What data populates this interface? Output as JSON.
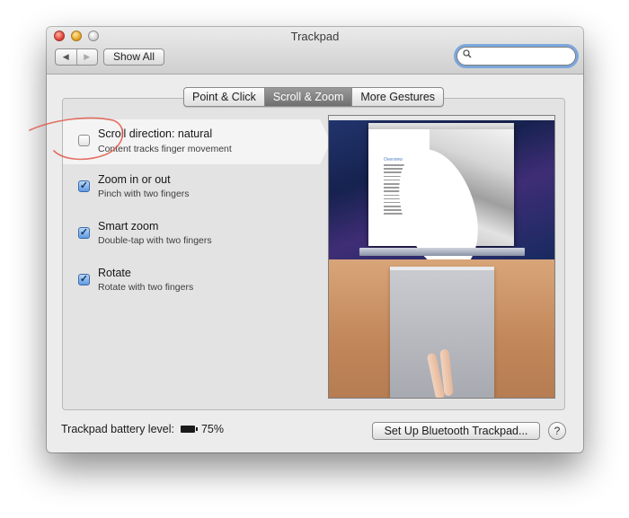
{
  "window": {
    "title": "Trackpad"
  },
  "toolbar": {
    "back_glyph": "◀",
    "forward_glyph": "▶",
    "show_all_label": "Show All",
    "search_placeholder": "",
    "search_icon": "search-icon"
  },
  "tabs": [
    {
      "label": "Point & Click",
      "active": false
    },
    {
      "label": "Scroll & Zoom",
      "active": true
    },
    {
      "label": "More Gestures",
      "active": false
    }
  ],
  "options": [
    {
      "title": "Scroll direction: natural",
      "subtitle": "Content tracks finger movement",
      "checked": false,
      "selected": true
    },
    {
      "title": "Zoom in or out",
      "subtitle": "Pinch with two fingers",
      "checked": true,
      "selected": false
    },
    {
      "title": "Smart zoom",
      "subtitle": "Double-tap with two fingers",
      "checked": true,
      "selected": false
    },
    {
      "title": "Rotate",
      "subtitle": "Rotate with two fingers",
      "checked": true,
      "selected": false
    }
  ],
  "preview": {
    "doc_heading": "Overview"
  },
  "footer": {
    "battery_label": "Trackpad battery level:",
    "battery_value": "75%",
    "setup_button": "Set Up Bluetooth Trackpad...",
    "help_button": "?"
  },
  "colors": {
    "annotation_circle": "#e0584a",
    "active_tab": "#7d7d7d",
    "search_focus": "#5c96dc"
  }
}
